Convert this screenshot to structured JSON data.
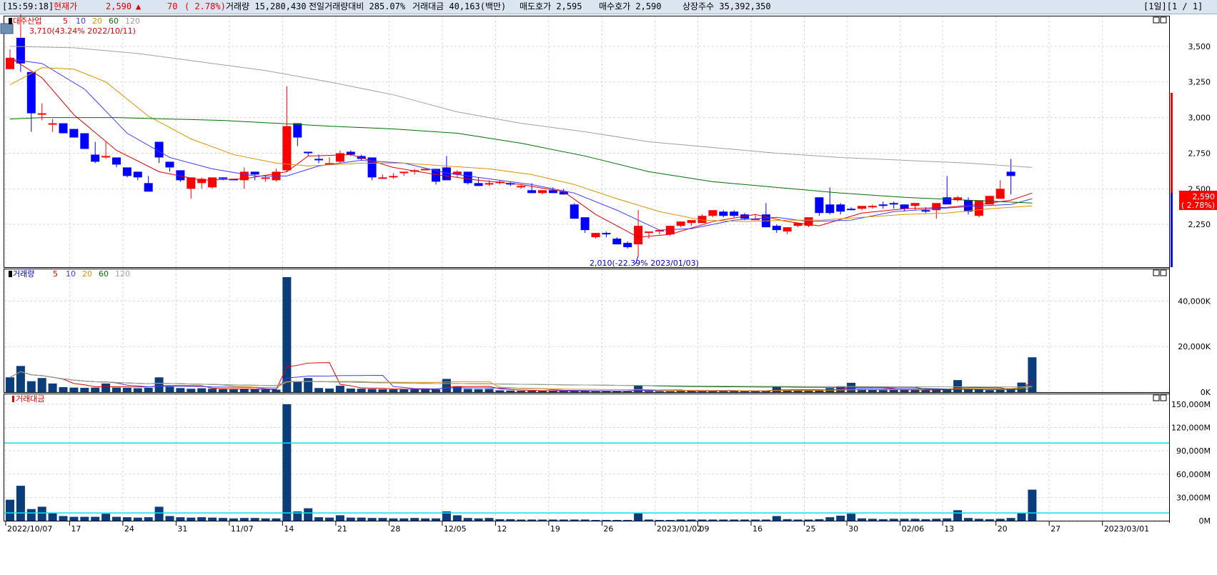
{
  "header": {
    "time": "[15:59:18]",
    "price_label": "현재가",
    "price": "2,590",
    "change_arrow": "▲",
    "change": "70",
    "change_pct": "( 2.78%)",
    "volume_text": "거래량 15,280,430",
    "prev_volume_ratio": "전일거래량대비 285.07%",
    "trade_value": "거래대금 40,163(백만)",
    "ask": "매도호가 2,595",
    "bid": "매수호가 2,590",
    "listed_shares": "상장주수 35,392,350",
    "period": "[1일][1 / 1]"
  },
  "colors": {
    "up": "#ff0000",
    "down": "#0000ff",
    "ma5": "#e00000",
    "ma10": "#3b3bff",
    "ma20": "#e09000",
    "ma60": "#007000",
    "ma120": "#a0a0a0",
    "bar": "#0a3d7a",
    "cyan": "#00e5ee"
  },
  "panels": {
    "price": {
      "legend_name": "대주산업",
      "ma_labels": [
        "5",
        "10",
        "20",
        "60",
        "120"
      ],
      "high_note": "3,710(43.24% 2022/10/11)",
      "low_note": "2,010(-22.39% 2023/01/03)",
      "current_price": "2,590",
      "current_pct": "( 2.78%)",
      "y_ticks": [
        "3,500",
        "3,250",
        "3,000",
        "2,750",
        "2,500",
        "2,250"
      ]
    },
    "volume": {
      "legend_name": "거래량",
      "ma_labels": [
        "5",
        "10",
        "20",
        "60",
        "120"
      ],
      "y_ticks": [
        "40,000K",
        "20,000K",
        "0K"
      ]
    },
    "value": {
      "legend_name": "거래대금",
      "y_ticks": [
        "150,000M",
        "120,000M",
        "90,000M",
        "60,000M",
        "30,000M",
        "0M"
      ]
    }
  },
  "x_labels": [
    "2022/10/07",
    "17",
    "24",
    "31",
    "11/07",
    "14",
    "21",
    "28",
    "12/05",
    "12",
    "19",
    "26",
    "2023/01/02",
    "09",
    "16",
    "25",
    "30",
    "02/06",
    "13",
    "20",
    "27",
    "2023/03/01"
  ],
  "chart_data": {
    "type": "candlestick",
    "candles": [
      [
        3340,
        3480,
        3340,
        3420
      ],
      [
        3560,
        3560,
        3320,
        3380
      ],
      [
        3320,
        3320,
        2900,
        3030
      ],
      [
        3030,
        3100,
        2980,
        3030
      ],
      [
        2950,
        2990,
        2900,
        2960
      ],
      [
        2960,
        2960,
        2890,
        2890
      ],
      [
        2920,
        2920,
        2860,
        2860
      ],
      [
        2890,
        2890,
        2780,
        2780
      ],
      [
        2740,
        2830,
        2680,
        2690
      ],
      [
        2730,
        2830,
        2710,
        2730
      ],
      [
        2720,
        2720,
        2650,
        2670
      ],
      [
        2650,
        2650,
        2580,
        2590
      ],
      [
        2620,
        2620,
        2560,
        2580
      ],
      [
        2540,
        2590,
        2490,
        2480
      ],
      [
        2830,
        2830,
        2680,
        2720
      ],
      [
        2690,
        2690,
        2620,
        2650
      ],
      [
        2630,
        2630,
        2550,
        2560
      ],
      [
        2500,
        2560,
        2430,
        2580
      ],
      [
        2540,
        2580,
        2500,
        2570
      ],
      [
        2510,
        2570,
        2500,
        2580
      ],
      [
        2580,
        2580,
        2560,
        2570
      ],
      [
        2570,
        2570,
        2560,
        2560
      ],
      [
        2560,
        2650,
        2500,
        2620
      ],
      [
        2620,
        2620,
        2560,
        2600
      ],
      [
        2570,
        2590,
        2550,
        2580
      ],
      [
        2560,
        2640,
        2550,
        2620
      ],
      [
        2630,
        3220,
        2620,
        2940
      ],
      [
        2960,
        2960,
        2800,
        2860
      ],
      [
        2760,
        2760,
        2730,
        2750
      ],
      [
        2710,
        2740,
        2680,
        2700
      ],
      [
        2680,
        2720,
        2670,
        2680
      ],
      [
        2690,
        2770,
        2680,
        2750
      ],
      [
        2760,
        2770,
        2730,
        2740
      ],
      [
        2730,
        2740,
        2700,
        2710
      ],
      [
        2720,
        2720,
        2560,
        2580
      ],
      [
        2580,
        2600,
        2570,
        2580
      ],
      [
        2580,
        2610,
        2570,
        2590
      ],
      [
        2610,
        2620,
        2590,
        2620
      ],
      [
        2620,
        2640,
        2600,
        2630
      ],
      [
        2630,
        2640,
        2630,
        2640
      ],
      [
        2640,
        2640,
        2530,
        2550
      ],
      [
        2650,
        2730,
        2650,
        2560
      ],
      [
        2600,
        2630,
        2580,
        2620
      ],
      [
        2620,
        2620,
        2530,
        2540
      ],
      [
        2540,
        2580,
        2520,
        2520
      ],
      [
        2540,
        2560,
        2520,
        2540
      ],
      [
        2540,
        2560,
        2530,
        2550
      ],
      [
        2540,
        2550,
        2520,
        2530
      ],
      [
        2510,
        2530,
        2500,
        2520
      ],
      [
        2490,
        2540,
        2470,
        2470
      ],
      [
        2470,
        2490,
        2460,
        2490
      ],
      [
        2490,
        2510,
        2470,
        2470
      ],
      [
        2480,
        2500,
        2460,
        2460
      ],
      [
        2390,
        2400,
        2300,
        2290
      ],
      [
        2300,
        2300,
        2190,
        2210
      ],
      [
        2160,
        2190,
        2150,
        2190
      ],
      [
        2190,
        2200,
        2160,
        2180
      ],
      [
        2150,
        2160,
        2110,
        2110
      ],
      [
        2120,
        2130,
        2080,
        2090
      ],
      [
        2110,
        2350,
        2030,
        2240
      ],
      [
        2190,
        2190,
        2150,
        2200
      ],
      [
        2200,
        2210,
        2180,
        2210
      ],
      [
        2180,
        2240,
        2170,
        2240
      ],
      [
        2240,
        2260,
        2230,
        2270
      ],
      [
        2260,
        2270,
        2240,
        2280
      ],
      [
        2260,
        2320,
        2260,
        2310
      ],
      [
        2310,
        2330,
        2300,
        2350
      ],
      [
        2340,
        2350,
        2300,
        2310
      ],
      [
        2340,
        2350,
        2300,
        2310
      ],
      [
        2320,
        2330,
        2280,
        2290
      ],
      [
        2290,
        2320,
        2280,
        2290
      ],
      [
        2320,
        2400,
        2240,
        2230
      ],
      [
        2240,
        2250,
        2190,
        2210
      ],
      [
        2200,
        2220,
        2180,
        2230
      ],
      [
        2240,
        2260,
        2230,
        2260
      ],
      [
        2240,
        2260,
        2230,
        2300
      ],
      [
        2440,
        2440,
        2310,
        2330
      ],
      [
        2390,
        2510,
        2320,
        2330
      ],
      [
        2390,
        2400,
        2320,
        2340
      ],
      [
        2360,
        2370,
        2350,
        2350
      ],
      [
        2360,
        2370,
        2350,
        2380
      ],
      [
        2380,
        2390,
        2360,
        2380
      ],
      [
        2390,
        2410,
        2360,
        2380
      ],
      [
        2400,
        2410,
        2360,
        2390
      ],
      [
        2390,
        2390,
        2340,
        2360
      ],
      [
        2380,
        2400,
        2350,
        2400
      ],
      [
        2350,
        2370,
        2330,
        2340
      ],
      [
        2350,
        2390,
        2290,
        2400
      ],
      [
        2440,
        2590,
        2420,
        2390
      ],
      [
        2420,
        2450,
        2410,
        2440
      ],
      [
        2420,
        2440,
        2320,
        2340
      ],
      [
        2310,
        2410,
        2300,
        2420
      ],
      [
        2390,
        2450,
        2390,
        2450
      ],
      [
        2430,
        2560,
        2430,
        2500
      ],
      [
        2620,
        2710,
        2460,
        2590
      ]
    ],
    "ma": {
      "ma5": [
        [
          0,
          3420
        ],
        [
          3,
          3280
        ],
        [
          6,
          3020
        ],
        [
          10,
          2770
        ],
        [
          14,
          2620
        ],
        [
          18,
          2560
        ],
        [
          22,
          2570
        ],
        [
          26,
          2620
        ],
        [
          28,
          2730
        ],
        [
          32,
          2740
        ],
        [
          36,
          2650
        ],
        [
          40,
          2600
        ],
        [
          44,
          2560
        ],
        [
          48,
          2530
        ],
        [
          52,
          2480
        ],
        [
          55,
          2320
        ],
        [
          59,
          2160
        ],
        [
          62,
          2180
        ],
        [
          66,
          2270
        ],
        [
          70,
          2320
        ],
        [
          73,
          2270
        ],
        [
          76,
          2240
        ],
        [
          80,
          2330
        ],
        [
          84,
          2360
        ],
        [
          88,
          2370
        ],
        [
          91,
          2390
        ],
        [
          94,
          2420
        ],
        [
          96,
          2470
        ]
      ],
      "ma10": [
        [
          0,
          3410
        ],
        [
          3,
          3380
        ],
        [
          7,
          3200
        ],
        [
          11,
          2890
        ],
        [
          15,
          2720
        ],
        [
          19,
          2640
        ],
        [
          23,
          2590
        ],
        [
          26,
          2590
        ],
        [
          29,
          2660
        ],
        [
          33,
          2700
        ],
        [
          37,
          2680
        ],
        [
          41,
          2610
        ],
        [
          45,
          2570
        ],
        [
          49,
          2530
        ],
        [
          53,
          2470
        ],
        [
          57,
          2350
        ],
        [
          61,
          2210
        ],
        [
          64,
          2220
        ],
        [
          68,
          2280
        ],
        [
          72,
          2300
        ],
        [
          75,
          2270
        ],
        [
          79,
          2280
        ],
        [
          83,
          2340
        ],
        [
          87,
          2360
        ],
        [
          91,
          2380
        ],
        [
          94,
          2390
        ],
        [
          96,
          2430
        ]
      ],
      "ma20": [
        [
          0,
          3230
        ],
        [
          3,
          3350
        ],
        [
          6,
          3340
        ],
        [
          9,
          3250
        ],
        [
          13,
          3010
        ],
        [
          17,
          2850
        ],
        [
          21,
          2740
        ],
        [
          25,
          2680
        ],
        [
          28,
          2660
        ],
        [
          33,
          2680
        ],
        [
          37,
          2680
        ],
        [
          41,
          2660
        ],
        [
          45,
          2640
        ],
        [
          49,
          2600
        ],
        [
          53,
          2530
        ],
        [
          57,
          2430
        ],
        [
          61,
          2340
        ],
        [
          65,
          2280
        ],
        [
          69,
          2270
        ],
        [
          73,
          2280
        ],
        [
          76,
          2280
        ],
        [
          80,
          2300
        ],
        [
          84,
          2320
        ],
        [
          88,
          2330
        ],
        [
          92,
          2360
        ],
        [
          96,
          2380
        ]
      ],
      "ma60": [
        [
          0,
          2990
        ],
        [
          3,
          3000
        ],
        [
          10,
          3000
        ],
        [
          20,
          2980
        ],
        [
          30,
          2940
        ],
        [
          36,
          2920
        ],
        [
          42,
          2890
        ],
        [
          48,
          2820
        ],
        [
          54,
          2730
        ],
        [
          60,
          2620
        ],
        [
          66,
          2550
        ],
        [
          72,
          2510
        ],
        [
          78,
          2470
        ],
        [
          84,
          2440
        ],
        [
          90,
          2420
        ],
        [
          96,
          2400
        ]
      ],
      "ma120": [
        [
          0,
          3500
        ],
        [
          6,
          3490
        ],
        [
          12,
          3450
        ],
        [
          18,
          3390
        ],
        [
          24,
          3330
        ],
        [
          30,
          3250
        ],
        [
          36,
          3160
        ],
        [
          42,
          3040
        ],
        [
          48,
          2960
        ],
        [
          54,
          2900
        ],
        [
          60,
          2830
        ],
        [
          66,
          2790
        ],
        [
          72,
          2750
        ],
        [
          78,
          2720
        ],
        [
          84,
          2700
        ],
        [
          90,
          2680
        ],
        [
          96,
          2650
        ]
      ]
    },
    "volume_k": [
      6500,
      11500,
      4800,
      6200,
      3800,
      2200,
      2000,
      1900,
      2000,
      3800,
      2000,
      1900,
      1700,
      1900,
      6500,
      2400,
      1800,
      1500,
      1700,
      1500,
      1300,
      1200,
      1300,
      1300,
      1200,
      1100,
      50500,
      4800,
      6200,
      1800,
      1600,
      2800,
      1600,
      1500,
      1400,
      1300,
      1200,
      1200,
      1300,
      1200,
      1200,
      5800,
      2600,
      1400,
      1300,
      1400,
      800,
      700,
      600,
      600,
      500,
      600,
      500,
      500,
      700,
      400,
      400,
      400,
      400,
      3000,
      500,
      400,
      400,
      500,
      500,
      500,
      600,
      600,
      600,
      500,
      600,
      700,
      2500,
      800,
      600,
      600,
      800,
      1800,
      2600,
      4100,
      1300,
      1000,
      900,
      1000,
      1100,
      1000,
      900,
      1100,
      1200,
      5300,
      1500,
      1100,
      900,
      1000,
      1500,
      4200,
      15300
    ],
    "value_m": [
      27000,
      45000,
      15000,
      18000,
      10000,
      6000,
      5000,
      5000,
      5000,
      9000,
      5000,
      4500,
      4000,
      4500,
      18000,
      6000,
      4500,
      4000,
      4500,
      4000,
      3500,
      3000,
      3500,
      3500,
      3000,
      3000,
      150000,
      12000,
      16000,
      4500,
      4000,
      7000,
      4000,
      4000,
      3500,
      3500,
      3000,
      3000,
      3500,
      3000,
      3000,
      12000,
      7000,
      3500,
      3000,
      3500,
      2000,
      2000,
      1500,
      1500,
      1500,
      1500,
      1500,
      1500,
      1500,
      1000,
      1000,
      1000,
      1000,
      9500,
      1500,
      1000,
      1000,
      1500,
      1500,
      1500,
      1500,
      1500,
      1500,
      1500,
      1500,
      1500,
      6000,
      2000,
      1500,
      1500,
      2000,
      4500,
      6500,
      9000,
      3000,
      2500,
      2000,
      2500,
      2500,
      2500,
      2000,
      2500,
      3000,
      13500,
      3500,
      2500,
      2000,
      2500,
      3500,
      10500,
      40000
    ],
    "value_lines_m": [
      100000,
      10000
    ],
    "ylim_price": [
      1950,
      3700
    ],
    "ylim_volume_k": [
      0,
      53000
    ],
    "ylim_value_m": [
      0,
      160000
    ]
  }
}
